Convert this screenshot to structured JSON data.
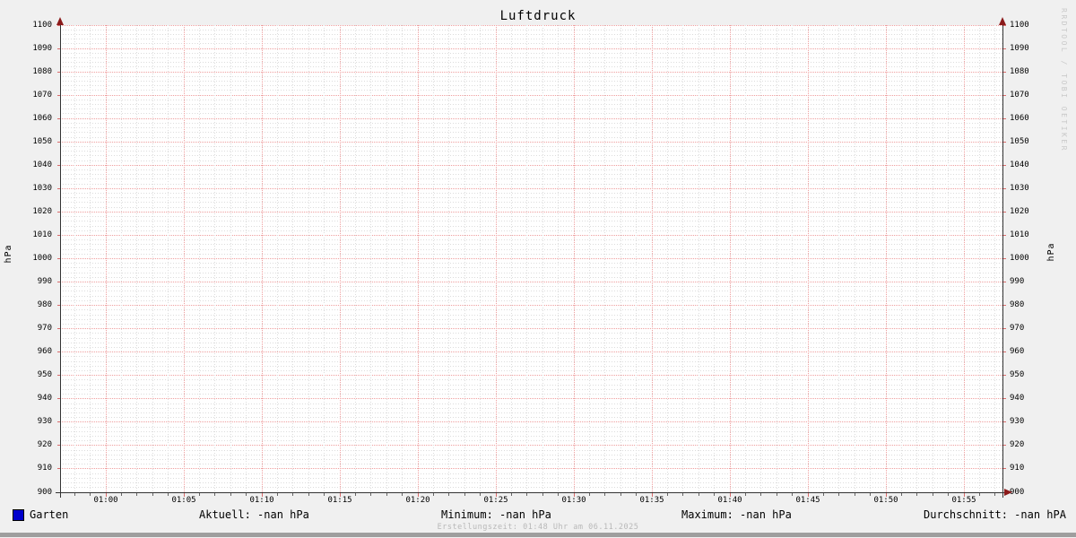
{
  "chart_data": {
    "type": "line",
    "title": "Luftdruck",
    "ylabel": "hPa",
    "ylabel_right": "hPa",
    "ylim": [
      900,
      1100
    ],
    "y_major_step": 10,
    "y_minor_step": 2,
    "x_tick_labels": [
      "01:00",
      "01:05",
      "01:10",
      "01:15",
      "01:20",
      "01:25",
      "01:30",
      "01:35",
      "01:40",
      "01:45",
      "01:50",
      "01:55"
    ],
    "x_minutes_per_major": 5,
    "x_minor_before_first": 2,
    "x_minor_after_last": 2,
    "grid": true,
    "legend_position": "bottom-left",
    "series": [
      {
        "name": "Garten",
        "color": "#0000cc",
        "values": []
      }
    ]
  },
  "legend": {
    "items": [
      {
        "label": "Garten",
        "color": "#0000cc"
      }
    ]
  },
  "stats": {
    "aktuell": "Aktuell: -nan hPa",
    "minimum": "Minimum: -nan hPa",
    "maximum": "Maximum: -nan hPa",
    "durchschnitt": "Durchschnitt: -nan hPA"
  },
  "footer": {
    "text": "Erstellungszeit: 01:48 Uhr am 06.11.2025"
  },
  "watermark": {
    "text": "RRDTOOL / TOBI OETIKER"
  },
  "colors": {
    "background": "#f0f0f0",
    "plot_background": "#ffffff",
    "major_grid": "#ef9f9f",
    "minor_grid": "#dcdcdc",
    "axis": "#333333",
    "arrow": "#8b1a1a",
    "major_tick": "#d96a6a",
    "minor_tick": "#666666",
    "text": "#000000",
    "footer_text": "#b8b8b8",
    "watermark_text": "#c9c9c9",
    "legend_swatch": "#0000cc"
  }
}
